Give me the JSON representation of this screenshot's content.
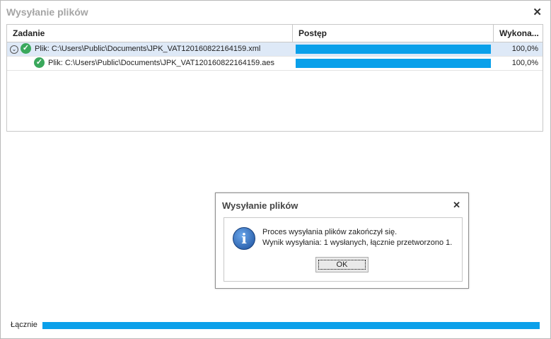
{
  "window": {
    "title": "Wysyłanie plików"
  },
  "grid": {
    "headers": {
      "task": "Zadanie",
      "progress": "Postęp",
      "done": "Wykona..."
    },
    "rows": [
      {
        "text": "Plik: C:\\Users\\Public\\Documents\\JPK_VAT120160822164159.xml",
        "progress": 1.0,
        "percent": "100,0%",
        "level": 0,
        "selected": true
      },
      {
        "text": "Plik: C:\\Users\\Public\\Documents\\JPK_VAT120160822164159.aes",
        "progress": 1.0,
        "percent": "100,0%",
        "level": 1,
        "selected": false
      }
    ]
  },
  "dialog": {
    "title": "Wysyłanie plików",
    "line1": "Proces wysyłania plików zakończył się.",
    "line2": "Wynik wysyłania: 1 wysłanych, łącznie przetworzono 1.",
    "ok_label": "OK",
    "icon": "info-icon"
  },
  "total": {
    "label": "Łącznie",
    "progress": 1.0
  },
  "colors": {
    "progress": "#0aa0ea",
    "selected_row": "#dee9f7",
    "check": "#3aa85c"
  }
}
